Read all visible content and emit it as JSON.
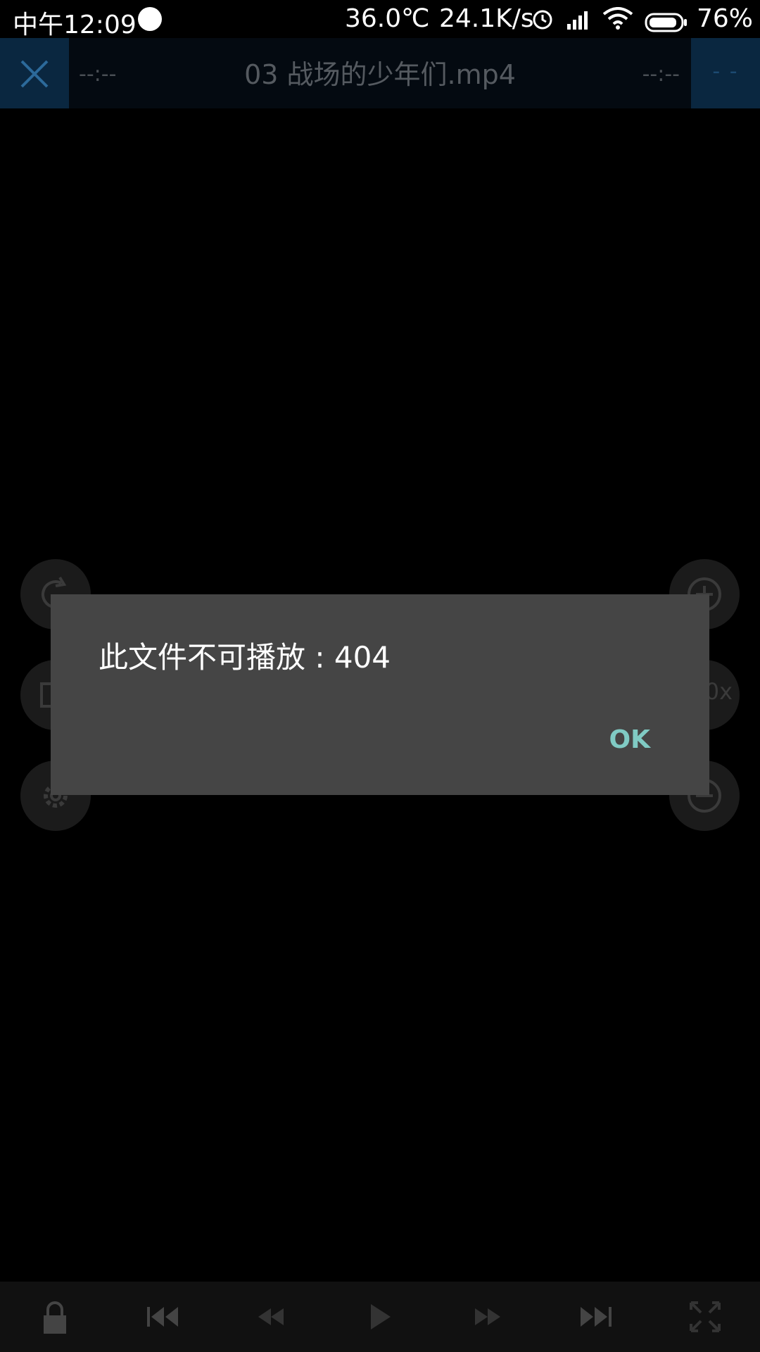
{
  "status_bar": {
    "time": "中午12:09",
    "temperature": "36.0℃",
    "net_speed": "24.1K/s",
    "battery_pct": "76%",
    "icons": [
      "app-notification-icon",
      "alarm-icon",
      "signal-icon",
      "wifi-icon",
      "battery-icon"
    ]
  },
  "player": {
    "title": "03  战场的少年们.mp4",
    "elapsed": "--:--",
    "remaining": "--:--",
    "top_right_label": "- -",
    "speed_label": "0x"
  },
  "dialog": {
    "message": "此文件不可播放 : 404",
    "ok_label": "OK"
  },
  "controls": [
    "lock-icon",
    "skip-previous-icon",
    "rewind-icon",
    "play-icon",
    "fast-forward-icon",
    "skip-next-icon",
    "fullscreen-icon"
  ],
  "colors": {
    "accent": "#80cbc4",
    "dialog_bg": "#454545",
    "top_button_bg": "#0a2740"
  }
}
